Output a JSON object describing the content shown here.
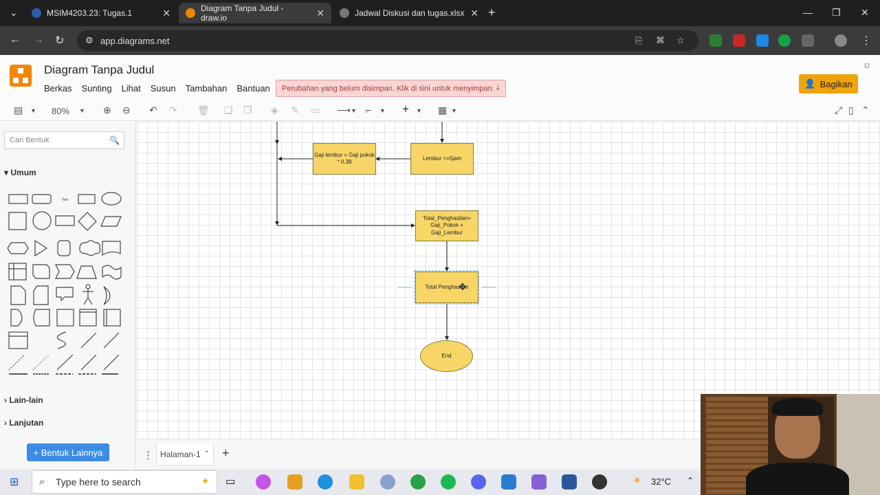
{
  "browser": {
    "tabs": [
      {
        "title": "MSIM4203.23: Tugas.1"
      },
      {
        "title": "Diagram Tanpa Judul - draw.io"
      },
      {
        "title": "Jadwal Diskusi dan tugas.xlsx"
      }
    ],
    "new_tab": "+",
    "url": "app.diagrams.net"
  },
  "app": {
    "title": "Diagram Tanpa Judul",
    "menu": [
      "Berkas",
      "Sunting",
      "Lihat",
      "Susun",
      "Tambahan",
      "Bantuan"
    ],
    "unsaved_notice": "Perubahan yang belum disimpan. Klik di sini untuk menyimpan.",
    "share_label": "Bagikan",
    "accent": "#f08705"
  },
  "toolbar": {
    "zoom": "80%"
  },
  "sidebar": {
    "search_placeholder": "Cari Bentuk",
    "section_general": "Umum",
    "section_misc": "Lain-lain",
    "section_advanced": "Lanjutan",
    "more_shapes": "+ Bentuk Lainnya",
    "text_shape_label": "Text"
  },
  "diagram": {
    "node_overtime_pay": "Gaji lembur = Gaji pokok * 0.38",
    "node_overtime_check": "Lembur >=5jam",
    "node_total_calc": "Total_Penghasilan= Gaji_Pokok + Gaji_Lembur",
    "node_total_output": "Total Penghasilan",
    "node_end": "End",
    "node_fill": "#f7d667"
  },
  "pages": {
    "current": "Halaman-1",
    "add": "+"
  },
  "taskbar": {
    "search_placeholder": "Type here to search",
    "temperature": "32°C"
  }
}
